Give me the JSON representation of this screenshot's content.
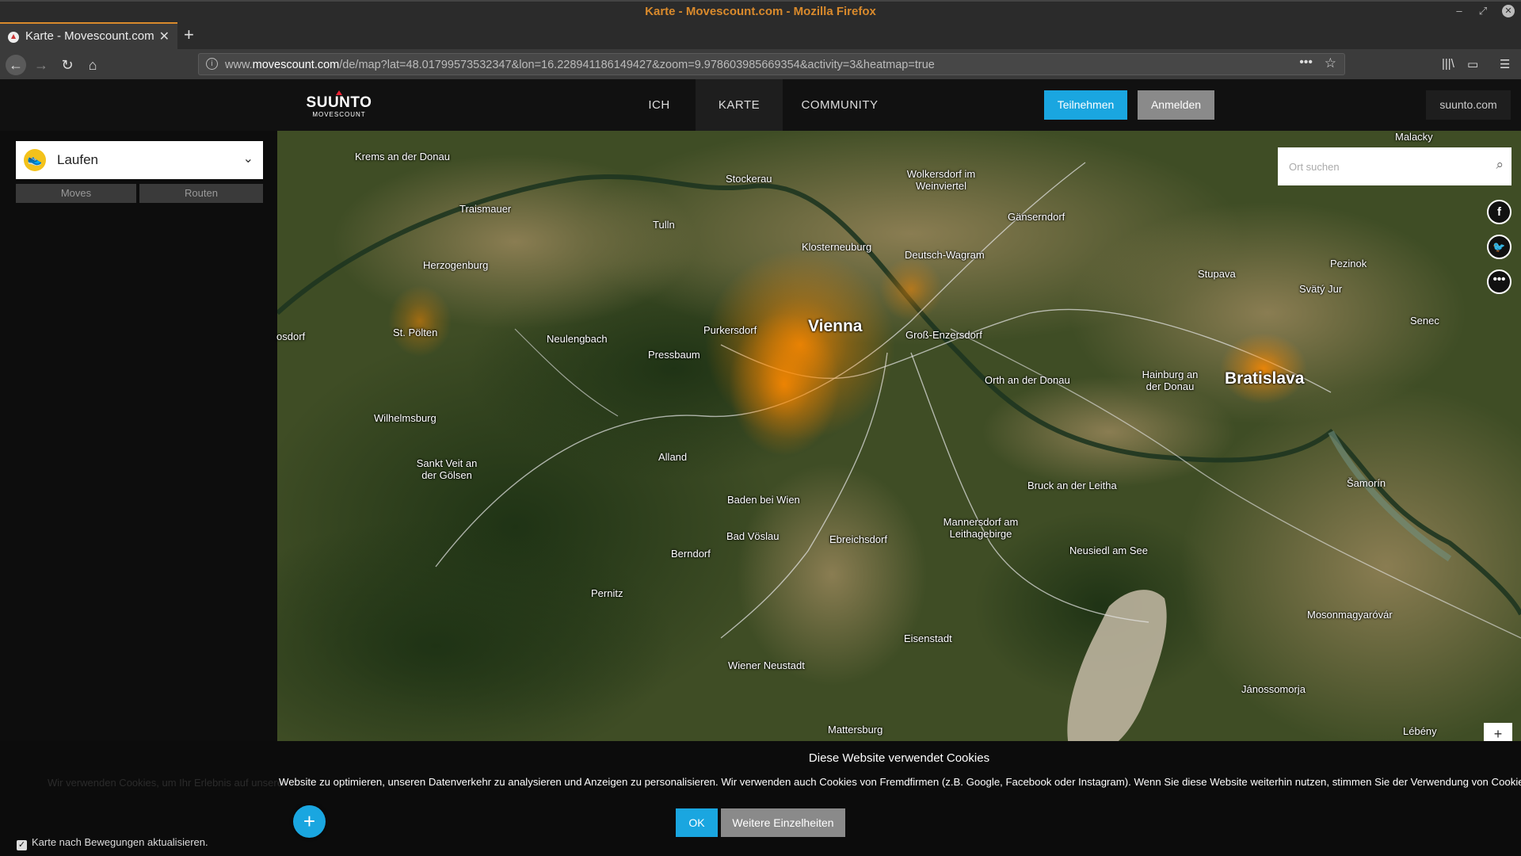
{
  "browser": {
    "window_title": "Karte - Movescount.com - Mozilla Firefox",
    "tab_title": "Karte - Movescount.com",
    "url_prefix": "www.",
    "url_domain": "movescount.com",
    "url_rest": "/de/map?lat=48.01799573532347&lon=16.228941186149427&zoom=9.978603985669354&activity=3&heatmap=true"
  },
  "header": {
    "logo_brand": "SUUNTO",
    "logo_sub": "MOVESCOUNT",
    "nav": [
      "ICH",
      "KARTE",
      "COMMUNITY"
    ],
    "join_label": "Teilnehmen",
    "login_label": "Anmelden",
    "external_link": "suunto.com"
  },
  "sidebar": {
    "activity": "Laufen",
    "tabs": [
      "Moves",
      "Routen"
    ],
    "auto_update_label": "Karte nach Bewegungen aktualisieren.",
    "auto_update_checked": true
  },
  "map": {
    "search_placeholder": "Ort suchen",
    "social_icons": [
      "facebook-icon",
      "twitter-icon",
      "more-icon"
    ],
    "places": [
      {
        "name": "Krems an der Donau"
      },
      {
        "name": "Stockerau"
      },
      {
        "name": "Wolkersdorf im Weinviertel"
      },
      {
        "name": "Malacky"
      },
      {
        "name": "Traismauer"
      },
      {
        "name": "Tulln"
      },
      {
        "name": "Gänserndorf"
      },
      {
        "name": "Herzogenburg"
      },
      {
        "name": "Klosterneuburg"
      },
      {
        "name": "Deutsch-Wagram"
      },
      {
        "name": "Stupava"
      },
      {
        "name": "Pezinok"
      },
      {
        "name": "Svätý Jur"
      },
      {
        "name": "Senec"
      },
      {
        "name": "osdorf"
      },
      {
        "name": "St. Pölten"
      },
      {
        "name": "Neulengbach"
      },
      {
        "name": "Purkersdorf"
      },
      {
        "name": "Vienna"
      },
      {
        "name": "Groß-Enzersdorf"
      },
      {
        "name": "Pressbaum"
      },
      {
        "name": "Orth an der Donau"
      },
      {
        "name": "Hainburg an der Donau"
      },
      {
        "name": "Bratislava"
      },
      {
        "name": "Wilhelmsburg"
      },
      {
        "name": "Alland"
      },
      {
        "name": "Sankt Veit an der Gölsen"
      },
      {
        "name": "Bruck an der Leitha"
      },
      {
        "name": "Šamorín"
      },
      {
        "name": "Baden bei Wien"
      },
      {
        "name": "Mannersdorf am Leithagebirge"
      },
      {
        "name": "Bad Vöslau"
      },
      {
        "name": "Ebreichsdorf"
      },
      {
        "name": "Neusiedl am See"
      },
      {
        "name": "Berndorf"
      },
      {
        "name": "Pernitz"
      },
      {
        "name": "Mosonmagyaróvár"
      },
      {
        "name": "Eisenstadt"
      },
      {
        "name": "Wiener Neustadt"
      },
      {
        "name": "Jánossomorja"
      },
      {
        "name": "Mattersburg"
      },
      {
        "name": "Lébény"
      }
    ]
  },
  "cookie": {
    "title": "Diese Website verwendet Cookies",
    "ghost_text": "Wir verwenden Cookies, um Ihr Erlebnis auf unserer",
    "text": "Website zu optimieren, unseren Datenverkehr zu analysieren und Anzeigen zu personalisieren. Wir verwenden auch Cookies von Fremdfirmen (z.B. Google, Facebook oder Instagram). Wenn Sie diese Website weiterhin nutzen, stimmen Sie der Verwendung von Cookies zu.",
    "ok_label": "OK",
    "more_label": "Weitere Einzelheiten"
  },
  "colors": {
    "accent": "#1aa6e0",
    "firefox_title": "#d98a2c",
    "heatmap": "#ff8a00"
  }
}
